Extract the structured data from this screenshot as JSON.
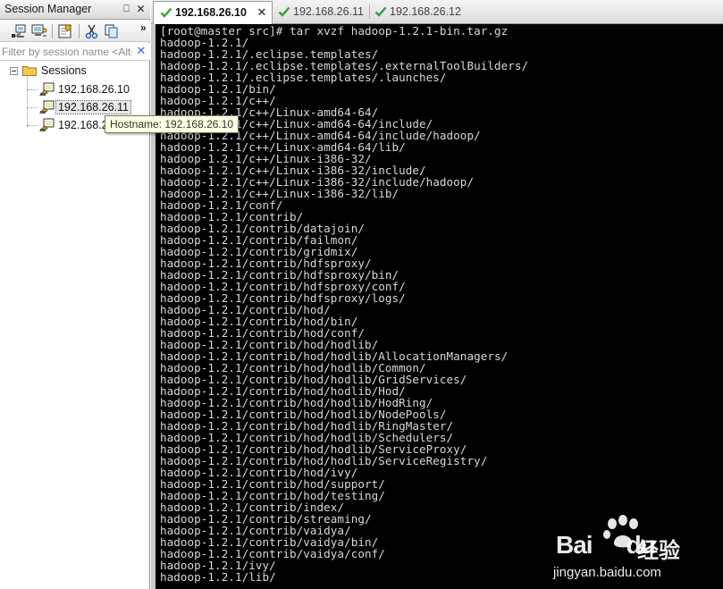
{
  "session_manager": {
    "title": "Session Manager",
    "pin_glyph": "⎕",
    "close_glyph": "✕",
    "more_glyph": "»",
    "filter": {
      "placeholder": "Filter by session name <Alt+I>",
      "value": "",
      "clear_glyph": "✕"
    },
    "toolbar_icons": [
      "connect-icon",
      "quick-connect-icon",
      "properties-icon",
      "cut-icon",
      "copy-icon"
    ],
    "tree": {
      "root": {
        "label": "Sessions",
        "expanded": true
      },
      "sessions": [
        {
          "label": "192.168.26.10",
          "selected": false
        },
        {
          "label": "192.168.26.11",
          "selected": true
        },
        {
          "label": "192.168.26.12",
          "selected": false
        }
      ]
    },
    "tooltip": "Hostname: 192.168.26.10"
  },
  "tabs": [
    {
      "label": "192.168.26.10",
      "active": true,
      "status": "connected",
      "close_glyph": "✕"
    },
    {
      "label": "192.168.26.11",
      "active": false,
      "status": "connected"
    },
    {
      "label": "192.168.26.12",
      "active": false,
      "status": "connected"
    }
  ],
  "colors": {
    "terminal_bg": "#000000",
    "terminal_fg": "#d8d8d8",
    "check_green": "#2ea43a",
    "folder_yellow": "#f2c94c"
  },
  "terminal": {
    "lines": [
      "[root@master src]# tar xvzf hadoop-1.2.1-bin.tar.gz",
      "hadoop-1.2.1/",
      "hadoop-1.2.1/.eclipse.templates/",
      "hadoop-1.2.1/.eclipse.templates/.externalToolBuilders/",
      "hadoop-1.2.1/.eclipse.templates/.launches/",
      "hadoop-1.2.1/bin/",
      "hadoop-1.2.1/c++/",
      "hadoop-1.2.1/c++/Linux-amd64-64/",
      "hadoop-1.2.1/c++/Linux-amd64-64/include/",
      "hadoop-1.2.1/c++/Linux-amd64-64/include/hadoop/",
      "hadoop-1.2.1/c++/Linux-amd64-64/lib/",
      "hadoop-1.2.1/c++/Linux-i386-32/",
      "hadoop-1.2.1/c++/Linux-i386-32/include/",
      "hadoop-1.2.1/c++/Linux-i386-32/include/hadoop/",
      "hadoop-1.2.1/c++/Linux-i386-32/lib/",
      "hadoop-1.2.1/conf/",
      "hadoop-1.2.1/contrib/",
      "hadoop-1.2.1/contrib/datajoin/",
      "hadoop-1.2.1/contrib/failmon/",
      "hadoop-1.2.1/contrib/gridmix/",
      "hadoop-1.2.1/contrib/hdfsproxy/",
      "hadoop-1.2.1/contrib/hdfsproxy/bin/",
      "hadoop-1.2.1/contrib/hdfsproxy/conf/",
      "hadoop-1.2.1/contrib/hdfsproxy/logs/",
      "hadoop-1.2.1/contrib/hod/",
      "hadoop-1.2.1/contrib/hod/bin/",
      "hadoop-1.2.1/contrib/hod/conf/",
      "hadoop-1.2.1/contrib/hod/hodlib/",
      "hadoop-1.2.1/contrib/hod/hodlib/AllocationManagers/",
      "hadoop-1.2.1/contrib/hod/hodlib/Common/",
      "hadoop-1.2.1/contrib/hod/hodlib/GridServices/",
      "hadoop-1.2.1/contrib/hod/hodlib/Hod/",
      "hadoop-1.2.1/contrib/hod/hodlib/HodRing/",
      "hadoop-1.2.1/contrib/hod/hodlib/NodePools/",
      "hadoop-1.2.1/contrib/hod/hodlib/RingMaster/",
      "hadoop-1.2.1/contrib/hod/hodlib/Schedulers/",
      "hadoop-1.2.1/contrib/hod/hodlib/ServiceProxy/",
      "hadoop-1.2.1/contrib/hod/hodlib/ServiceRegistry/",
      "hadoop-1.2.1/contrib/hod/ivy/",
      "hadoop-1.2.1/contrib/hod/support/",
      "hadoop-1.2.1/contrib/hod/testing/",
      "hadoop-1.2.1/contrib/index/",
      "hadoop-1.2.1/contrib/streaming/",
      "hadoop-1.2.1/contrib/vaidya/",
      "hadoop-1.2.1/contrib/vaidya/bin/",
      "hadoop-1.2.1/contrib/vaidya/conf/",
      "hadoop-1.2.1/ivy/",
      "hadoop-1.2.1/lib/"
    ]
  },
  "watermark": {
    "brand": "Bai",
    "brand_suffix": "du",
    "product": "经验",
    "url": "jingyan.baidu.com"
  }
}
